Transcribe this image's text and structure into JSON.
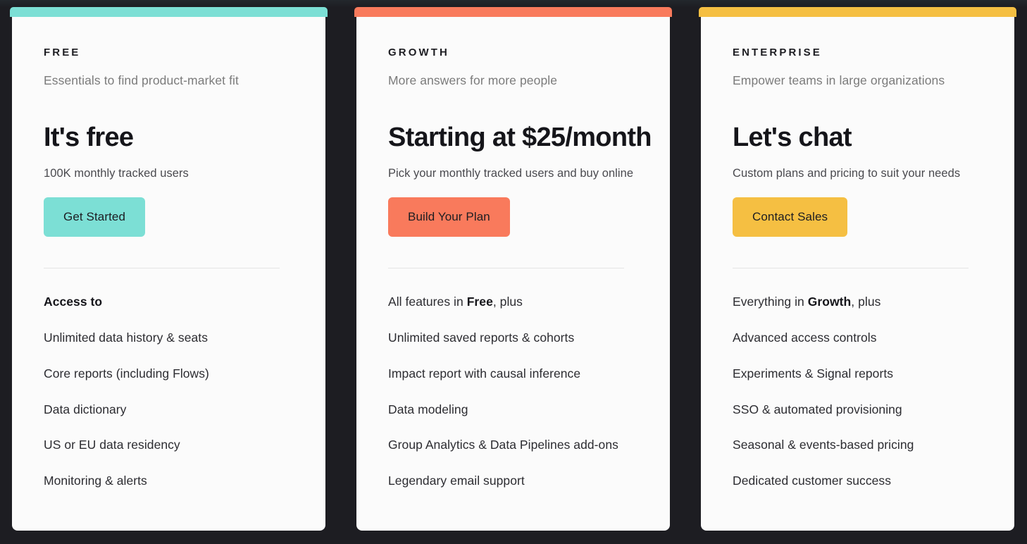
{
  "theme": {
    "page_background": "#1d1d22",
    "card_background": "#fbfbfb",
    "divider_color": "#e4e4e4",
    "heading_color": "#15151a",
    "tagline_color": "#7b7b7b",
    "feature_color": "#2c2c31"
  },
  "plans": [
    {
      "accent_color": "#7cdfd5",
      "eyebrow": "FREE",
      "tagline": "Essentials to find product-market fit",
      "headline": "It's free",
      "subcaption": "100K monthly tracked users",
      "cta_label": "Get Started",
      "features_heading": "Access to",
      "features_heading_bold": true,
      "features_heading_prefix": "",
      "features_heading_emphasis": "",
      "features_heading_suffix": "",
      "features": [
        "Unlimited data history & seats",
        "Core reports (including Flows)",
        "Data dictionary",
        "US or EU data residency",
        "Monitoring & alerts"
      ]
    },
    {
      "accent_color": "#f97a5c",
      "eyebrow": "GROWTH",
      "tagline": "More answers for more people",
      "headline": "Starting at $25/month",
      "subcaption": "Pick your monthly tracked users and buy online",
      "cta_label": "Build Your Plan",
      "features_heading": "All features in Free, plus",
      "features_heading_bold": false,
      "features_heading_prefix": "All features in ",
      "features_heading_emphasis": "Free",
      "features_heading_suffix": ", plus",
      "features": [
        "Unlimited saved reports & cohorts",
        "Impact report with causal inference",
        "Data modeling",
        "Group Analytics & Data Pipelines add-ons",
        "Legendary email support"
      ]
    },
    {
      "accent_color": "#f5bf42",
      "eyebrow": "ENTERPRISE",
      "tagline": "Empower teams in large organizations",
      "headline": "Let's chat",
      "subcaption": "Custom plans and pricing to suit your needs",
      "cta_label": "Contact Sales",
      "features_heading": "Everything in Growth, plus",
      "features_heading_bold": false,
      "features_heading_prefix": "Everything in ",
      "features_heading_emphasis": "Growth",
      "features_heading_suffix": ", plus",
      "features": [
        "Advanced access controls",
        "Experiments & Signal reports",
        "SSO & automated provisioning",
        "Seasonal & events-based pricing",
        "Dedicated customer success"
      ]
    }
  ]
}
